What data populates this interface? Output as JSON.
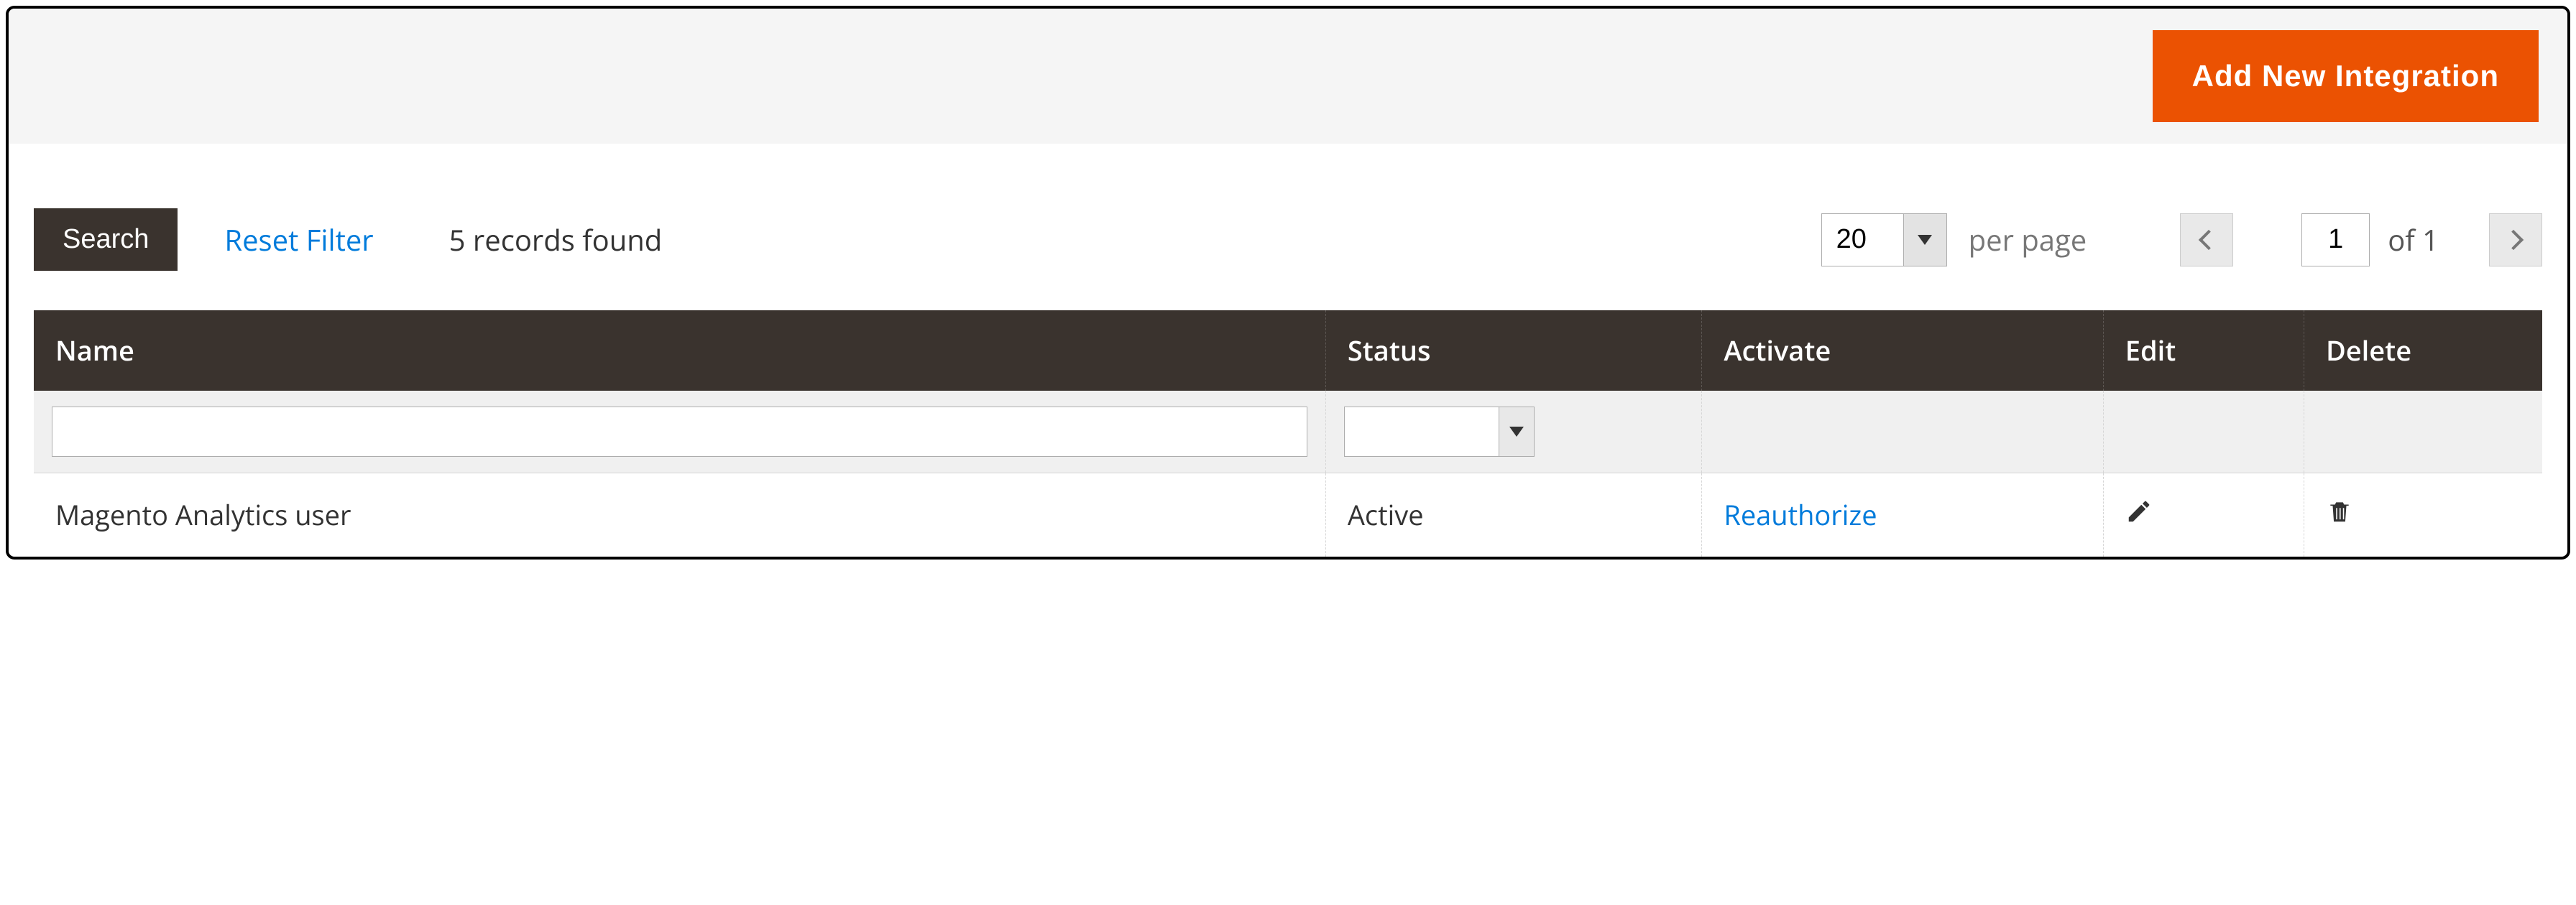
{
  "header": {
    "add_button_label": "Add New Integration"
  },
  "toolbar": {
    "search_label": "Search",
    "reset_filter_label": "Reset Filter",
    "records_found": "5 records found",
    "page_size": "20",
    "per_page_label": "per page",
    "current_page": "1",
    "total_pages_label": "of 1"
  },
  "table": {
    "headers": {
      "name": "Name",
      "status": "Status",
      "activate": "Activate",
      "edit": "Edit",
      "delete": "Delete"
    },
    "filters": {
      "name_value": "",
      "status_value": ""
    },
    "rows": [
      {
        "name": "Magento Analytics user",
        "status": "Active",
        "activate_label": "Reauthorize"
      }
    ]
  }
}
